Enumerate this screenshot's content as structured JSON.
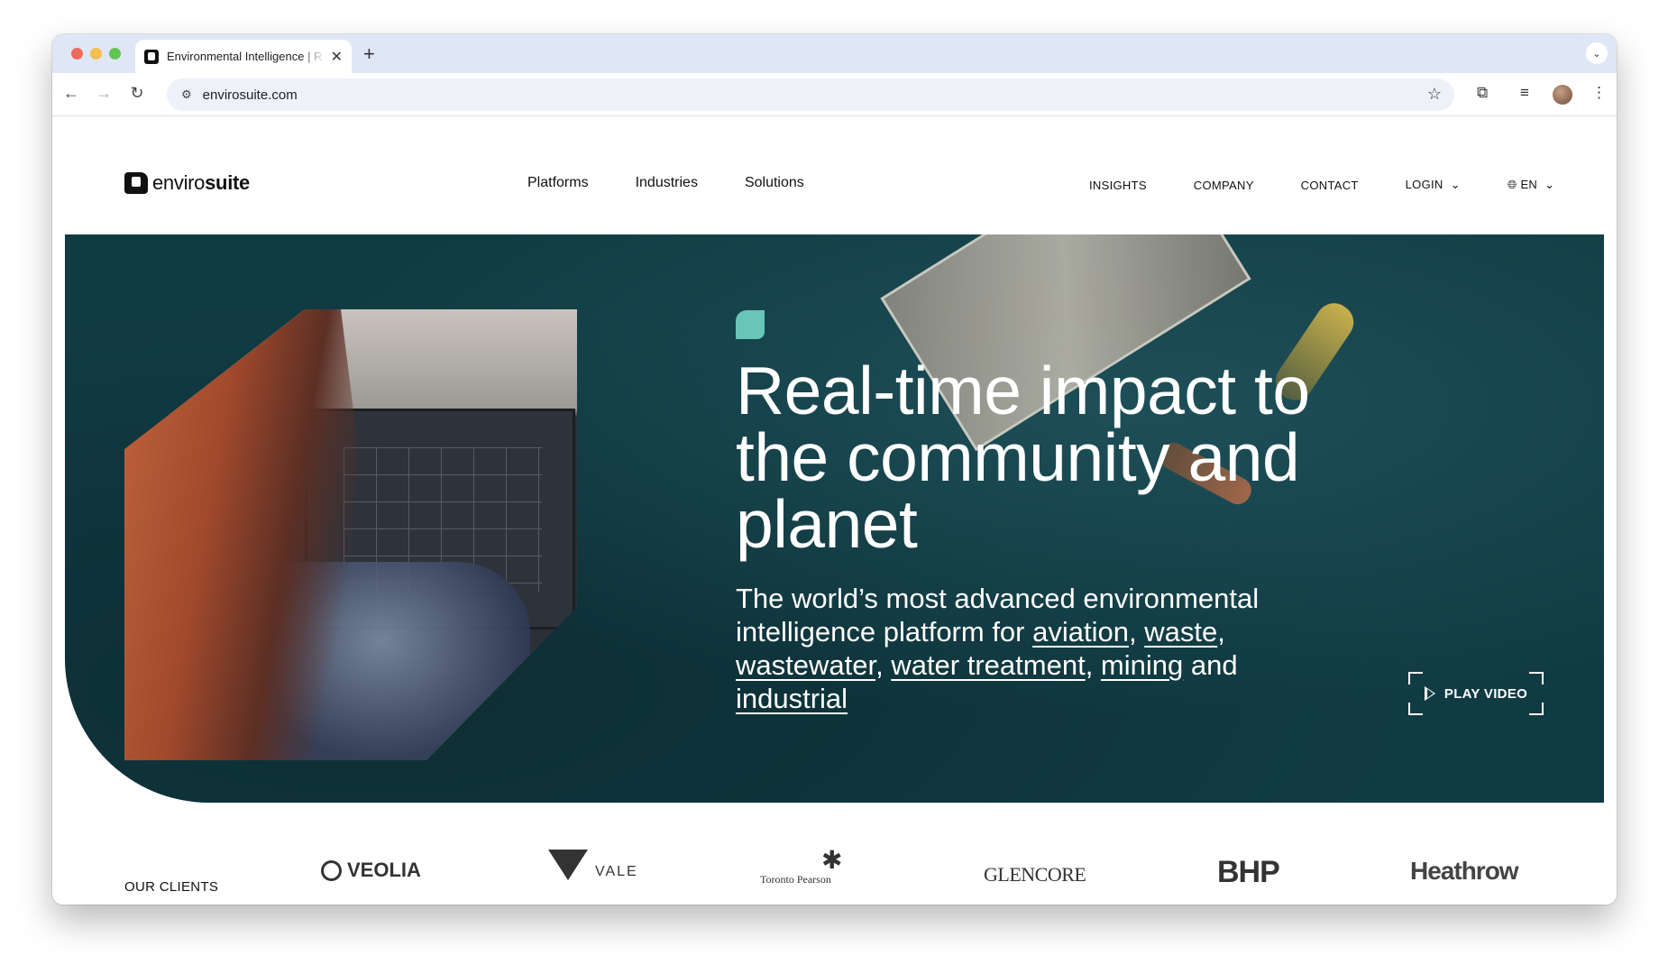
{
  "browser": {
    "tab_title": "Environmental Intelligence | R",
    "tab_close": "✕",
    "new_tab": "+",
    "tab_menu": "⌄",
    "url": "envirosuite.com",
    "icons": [
      "back-icon",
      "forward-icon",
      "reload-icon",
      "site-settings-icon",
      "bookmark-star-icon",
      "extensions-icon",
      "media-controls-icon",
      "profile-avatar",
      "kebab-menu-icon"
    ]
  },
  "header": {
    "logo_regular": "enviro",
    "logo_bold": "suite",
    "main_nav": [
      "Platforms",
      "Industries",
      "Solutions"
    ],
    "secondary_nav": {
      "insights": "INSIGHTS",
      "company": "COMPANY",
      "contact": "CONTACT",
      "login": "LOGIN",
      "language": "EN"
    }
  },
  "hero": {
    "headline": "Real-time impact to the community and planet",
    "subhead_prefix": "The world’s most advanced environmental intelligence platform for ",
    "links": [
      "aviation",
      "waste",
      "wastewater",
      "water treatment",
      "mining",
      "industrial"
    ],
    "sep_comma": ", ",
    "sep_and": " and ",
    "play_video": "PLAY VIDEO"
  },
  "clients": {
    "label": "OUR CLIENTS",
    "logos": [
      "VEOLIA",
      "VALE",
      "Toronto Pearson",
      "GLENCORE",
      "BHP",
      "Heathrow"
    ]
  },
  "colors": {
    "hero_bg": "#113b43",
    "accent": "#67c6b8",
    "tab_strip": "#dfe6f6",
    "omnibox": "#eef1f8"
  }
}
